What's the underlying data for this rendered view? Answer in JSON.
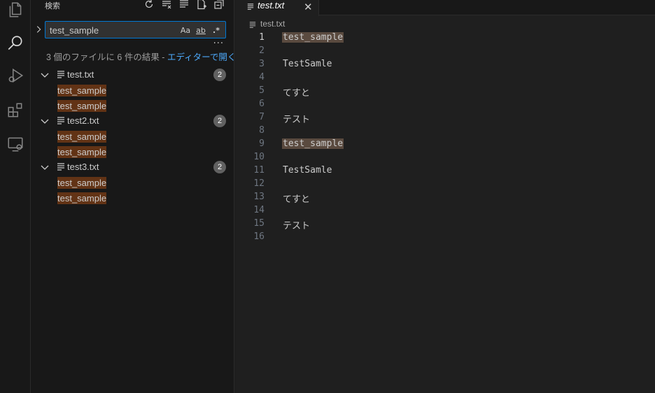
{
  "sidebar": {
    "title": "検索",
    "search": {
      "value": "test_sample",
      "opt_case": "Aa",
      "opt_word": "ab",
      "opt_regex": ".*"
    },
    "summary_text": "3 個のファイルに 6 件の結果 - ",
    "summary_link": "エディターで開く",
    "files": [
      {
        "name": "test.txt",
        "count": "2",
        "matches": [
          "test_sample",
          "test_sample"
        ]
      },
      {
        "name": "test2.txt",
        "count": "2",
        "matches": [
          "test_sample",
          "test_sample"
        ]
      },
      {
        "name": "test3.txt",
        "count": "2",
        "matches": [
          "test_sample",
          "test_sample"
        ]
      }
    ]
  },
  "editor": {
    "tab_label": "test.txt",
    "breadcrumb": "test.txt",
    "lines": [
      {
        "n": "1",
        "text": "test_sample"
      },
      {
        "n": "2",
        "text": ""
      },
      {
        "n": "3",
        "text": "TestSamle"
      },
      {
        "n": "4",
        "text": ""
      },
      {
        "n": "5",
        "text": "てすと"
      },
      {
        "n": "6",
        "text": ""
      },
      {
        "n": "7",
        "text": "テスト"
      },
      {
        "n": "8",
        "text": ""
      },
      {
        "n": "9",
        "text": "test_sample"
      },
      {
        "n": "10",
        "text": ""
      },
      {
        "n": "11",
        "text": "TestSamle"
      },
      {
        "n": "12",
        "text": ""
      },
      {
        "n": "13",
        "text": "てすと"
      },
      {
        "n": "14",
        "text": ""
      },
      {
        "n": "15",
        "text": "テスト"
      },
      {
        "n": "16",
        "text": ""
      }
    ]
  },
  "colors": {
    "accent": "#0078d4",
    "match_bg": "#623315",
    "link": "#4daafc"
  }
}
